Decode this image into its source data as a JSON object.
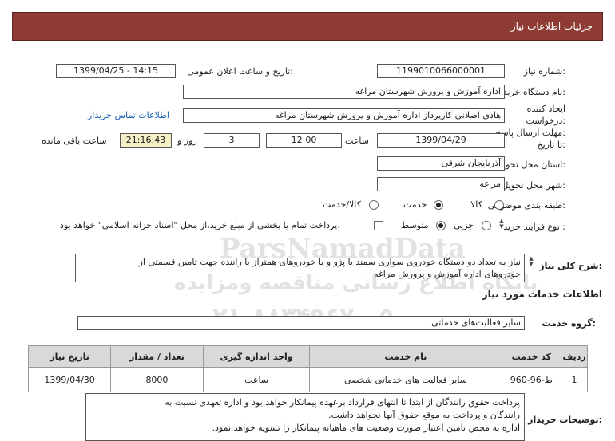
{
  "header": {
    "title": "جزئیات اطلاعات نیاز"
  },
  "fields": {
    "need_number_label": "شماره نیاز:",
    "need_number": "1199010066000001",
    "announce_label": "تاریخ و ساعت اعلان عمومی:",
    "announce_value": "1399/04/25 - 14:15",
    "buyer_label": "نام دستگاه خریدار:",
    "buyer_value": "اداره آموزش و پرورش شهرستان مراغه",
    "creator_label_1": "ایجاد کننده",
    "creator_label_2": "درخواست:",
    "creator_value": "هادی اصلانی کارپرداز اداره آموزش و پرورش شهرستان مراغه",
    "contact_link": "اطلاعات تماس خریدار",
    "deadline_label_1": "مهلت ارسال پاسخ:",
    "deadline_label_2": "تا تاریخ:",
    "deadline_date": "1399/04/29",
    "time_label": "ساعت",
    "deadline_time": "12:00",
    "days_value": "3",
    "days_label": "روز و",
    "remaining_time": "21:16:43",
    "remaining_label": "ساعت باقی مانده",
    "province_label": "استان محل تحویل:",
    "province_value": "آذربایجان شرقی",
    "city_label": "شهر محل تحویل:",
    "city_value": "مراغه",
    "category_label": "طبقه بندی موضوعی:",
    "category_options": [
      "کالا",
      "خدمت",
      "کالا/خدمت"
    ],
    "category_selected": "خدمت",
    "process_label": "نوع فرآیند خرید :",
    "process_options": [
      "جزیی",
      "متوسط"
    ],
    "process_selected": "متوسط",
    "payment_note": "پرداخت تمام یا بخشی از مبلغ خرید،از محل \"اسناد خزانه اسلامی\" خواهد بود."
  },
  "description": {
    "label": "شرح کلی نیاز:",
    "line1": "نیاز به تعداد دو دستگاه خودروی سواری سمند یا پژو و یا خودروهای همتراز با راننده جهت تامین قسمتی از",
    "line2": "خودروهای اداره آموزش و پرورش مراغه"
  },
  "services": {
    "section_title": "اطلاعات خدمات مورد نیاز",
    "group_label": "گروه خدمت:",
    "group_value": "سایر فعالیت‌های خدماتی"
  },
  "table": {
    "headers": [
      "ردیف",
      "کد خدمت",
      "نام خدمت",
      "واحد اندازه گیری",
      "تعداد / مقدار",
      "تاریخ نیاز"
    ],
    "rows": [
      [
        "1",
        "ط-96-960",
        "سایر فعالیت های خدماتی شخصی",
        "ساعت",
        "8000",
        "1399/04/30"
      ]
    ]
  },
  "buyer_notes": {
    "label": "توضیحات خریدار:",
    "line1": "پرداخت حقوق رانندگان از ابتدا تا انتهای قرارداد برعهده پیمانکار خواهد بود و اداره تعهدی نسبت به",
    "line2": "رانندگان و پرداخت به موقع حقوق آنها نخواهد داشت.",
    "line3": "اداره به محض تامین اعتبار صورت وضعیت های ماهیانه پیمانکار را تسویه خواهد نمود."
  },
  "watermark": {
    "brand": "ParsNamadData",
    "line1": "پایگاه اطلاع رسانی مناقصه ومزایده",
    "phone": "۰۲۱-۸۸۳۴۹۶۷۰-۵"
  }
}
